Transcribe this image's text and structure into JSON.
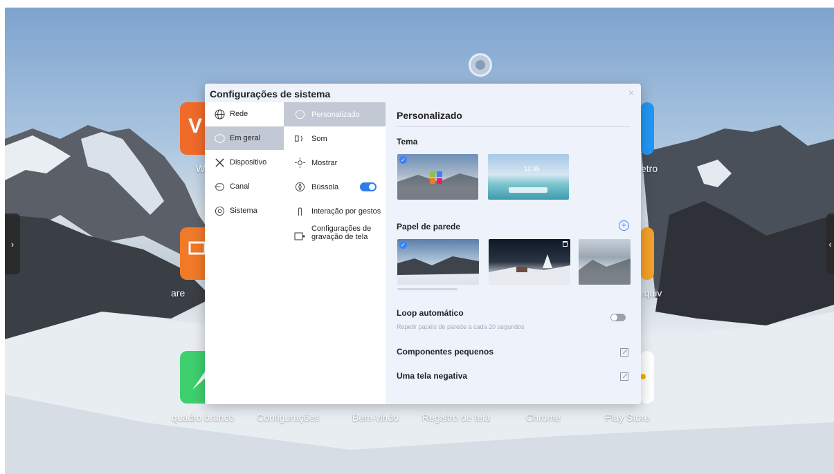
{
  "desktop": {
    "apps": [
      {
        "label": "quadro branco",
        "color": "#3ecf6e"
      },
      {
        "label": "Configurações",
        "color": ""
      },
      {
        "label": "Bem-vindo",
        "color": ""
      },
      {
        "label": "Registro de tela",
        "color": ""
      },
      {
        "label": "Chrome",
        "color": ""
      },
      {
        "label": "Play Store",
        "color": "#ffffff"
      }
    ],
    "partial_labels": {
      "w_left": "W",
      "are_left": "are",
      "etro_right": "etro",
      "rquiv_right": "rquiv"
    },
    "left_handle": "›",
    "right_handle": "‹",
    "accent_orange": "#f07a28",
    "accent_blue": "#2196f3"
  },
  "dialog": {
    "title": "Configurações de sistema",
    "close": "×",
    "categories": [
      {
        "label": "Rede",
        "icon": "globe-icon"
      },
      {
        "label": "Em geral",
        "icon": "cube-icon",
        "active": true
      },
      {
        "label": "Dispositivo",
        "icon": "tools-icon"
      },
      {
        "label": "Canal",
        "icon": "input-icon"
      },
      {
        "label": "Sistema",
        "icon": "gear-icon"
      }
    ],
    "subitems": [
      {
        "label": "Personalizado",
        "icon": "palette-icon",
        "active": true
      },
      {
        "label": "Som",
        "icon": "speaker-icon"
      },
      {
        "label": "Mostrar",
        "icon": "brightness-icon"
      },
      {
        "label": "Bússola",
        "icon": "compass-icon",
        "toggle": true
      },
      {
        "label": "Interação por gestos",
        "icon": "gesture-icon"
      },
      {
        "label_line1": "Configurações de",
        "label_line2": "gravação de tela",
        "icon": "record-icon"
      }
    ],
    "content": {
      "heading": "Personalizado",
      "theme_label": "Tema",
      "wallpaper_label": "Papel de parede",
      "add": "+",
      "auto_loop": {
        "title": "Loop automático",
        "subtitle": "Repetir papéis de parede a cada 20 segundos",
        "enabled": false
      },
      "small_components": "Componentes pequenos",
      "negative_screen": "Uma tela negativa",
      "theme_clock": "12:35"
    },
    "colors": {
      "toggle_on": "#2b7de9",
      "toggle_off": "#9aa2ad",
      "active_bg": "#c2c9d4",
      "check": "#3b82f6"
    }
  }
}
